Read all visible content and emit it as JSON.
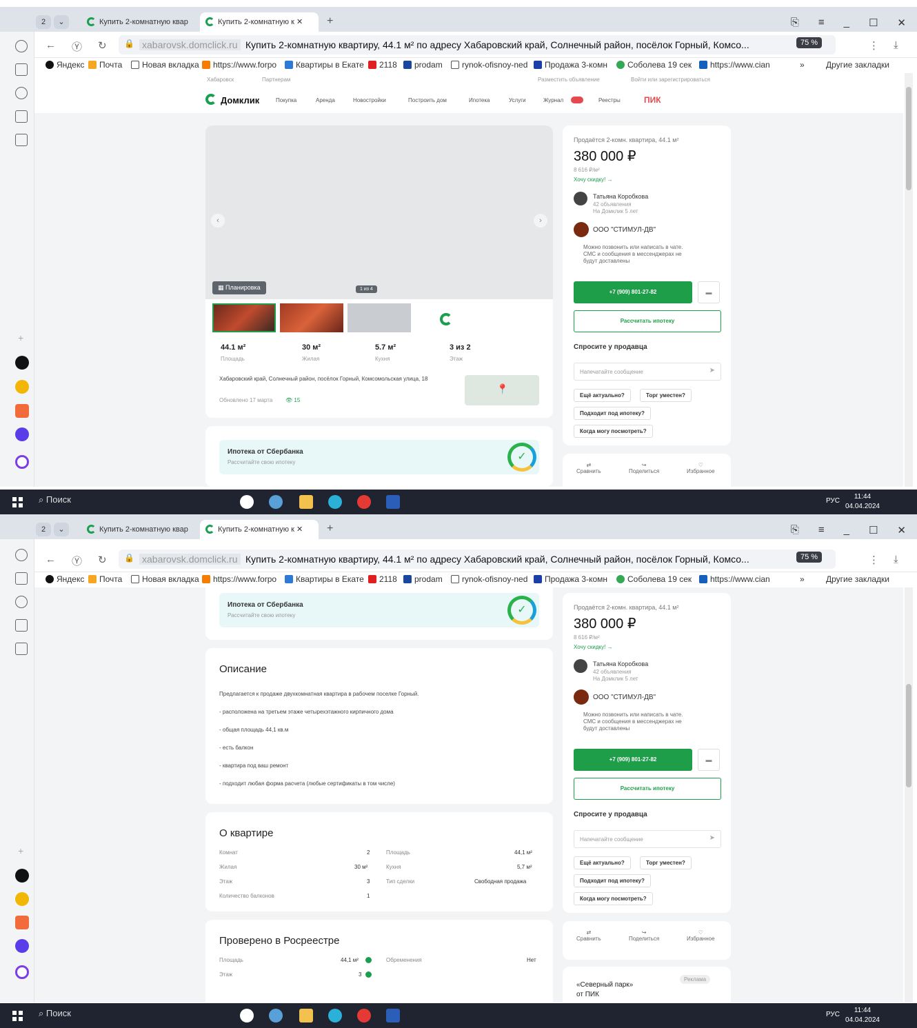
{
  "browser": {
    "tab_count": "2",
    "tabs": [
      {
        "label": "Купить 2-комнатную квар"
      },
      {
        "label": "Купить 2-комнатную к"
      }
    ],
    "domain": "xabarovsk.domclick.ru",
    "page_title": "Купить 2-комнатную квартиру, 44.1 м² по адресу Хабаровский край, Солнечный район, посёлок Горный, Комсо...",
    "zoom": "75 %",
    "bookmarks": [
      "Яндекс",
      "Почта",
      "Новая вкладка",
      "https://www.forpo",
      "Квартиры в Екате",
      "2118",
      "prodam",
      "rynok-ofisnoy-ned",
      "Продажа 3-комн",
      "Соболева 19 сек",
      "https://www.cian",
      "»",
      "Другие закладки"
    ]
  },
  "site": {
    "topbar": [
      "Хабаровск",
      "Партнерам",
      "Разместить объявление",
      "Войти или зарегистрироваться"
    ],
    "logo": "Домклик",
    "nav": [
      "Покупка",
      "Аренда",
      "Новостройки",
      "Построить дом",
      "Ипотека",
      "Услуги",
      "Журнал",
      "Реестры"
    ],
    "pik": "ПИК"
  },
  "gallery": {
    "plan_label": "Планировка",
    "counter": "1 из 4"
  },
  "facts": [
    {
      "v": "44.1 м²",
      "l": "Площадь"
    },
    {
      "v": "30 м²",
      "l": "Жилая"
    },
    {
      "v": "5.7 м²",
      "l": "Кухня"
    },
    {
      "v": "3 из 2",
      "l": "Этаж"
    }
  ],
  "address": "Хабаровский край, Солнечный район, посёлок Горный, Комсомольская улица, 18",
  "updated": "Обновлено 17 марта",
  "views": "15",
  "promo": {
    "title": "Ипотека от Сбербанка",
    "sub": "Рассчитайте свою ипотеку"
  },
  "seller": {
    "heading": "Продаётся 2-комн. квартира, 44.1 м²",
    "price": "380 000 ₽",
    "per_m2": "8 616 ₽/м²",
    "discount": "Хочу скидку! →",
    "agent": "Татьяна Коробкова",
    "agent_ads": "42 объявления",
    "agent_years": "На Домклик 5 лет",
    "company": "ООО \"СТИМУЛ-ДВ\"",
    "contact_note": "Можно позвонить или написать в чате. СМС и сообщения в мессенджерах не будут доставлены",
    "phone": "+7 (909) 801-27-82",
    "mortgage_btn": "Рассчитать ипотеку",
    "ask_heading": "Спросите у продавца",
    "msg_placeholder": "Напечатайте сообщение",
    "chips": [
      "Ещё актуально?",
      "Торг уместен?",
      "Подходит под ипотеку?",
      "Когда могу посмотреть?"
    ],
    "actions": [
      "Сравнить",
      "Поделиться",
      "Избранное"
    ]
  },
  "description": {
    "heading": "Описание",
    "lines": [
      "Предлагается к продаже двухкомнатная квартира в рабочем поселке Горный.",
      "- расположена на третьем этаже четырехэтажного кирпичного дома",
      "- общая площадь 44,1 кв.м",
      "- есть балкон",
      "- квартира под ваш ремонт",
      "- подходит любая форма расчета (любые сертификаты в том числе)"
    ]
  },
  "about": {
    "heading": "О квартире",
    "left": [
      [
        "Комнат",
        "2"
      ],
      [
        "Жилая",
        "30 м²"
      ],
      [
        "Этаж",
        "3"
      ],
      [
        "Количество балконов",
        "1"
      ]
    ],
    "right": [
      [
        "Площадь",
        "44,1 м²"
      ],
      [
        "Кухня",
        "5,7 м²"
      ],
      [
        "Тип сделки",
        "Свободная продажа"
      ]
    ]
  },
  "rosreestr": {
    "heading": "Проверено в Росреестре",
    "rows": [
      [
        "Площадь",
        "44,1 м²"
      ],
      [
        "Этаж",
        "3"
      ]
    ],
    "enc_label": "Обременения",
    "enc_value": "Нет"
  },
  "ad": {
    "title": "«Северный парк»",
    "sub": "от ПИК",
    "tag": "Реклама"
  },
  "taskbar": {
    "search": "Поиск",
    "lang": "РУС",
    "time": "11:44",
    "date": "04.04.2024"
  }
}
